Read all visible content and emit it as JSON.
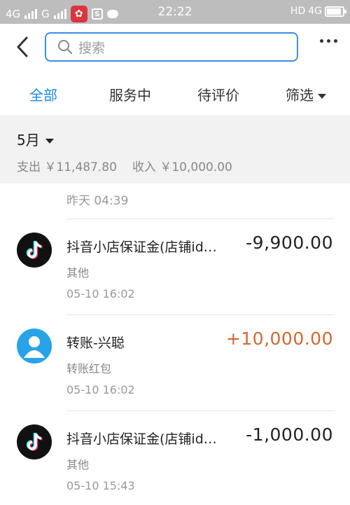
{
  "status_bar": {
    "left_net1": "4G",
    "left_net2": "G",
    "app_icon_glyph": "✿",
    "sq_icon_glyph": "S",
    "time": "22:22",
    "right_label": "HD",
    "right_net": "4G"
  },
  "search": {
    "placeholder": "搜索"
  },
  "tabs": [
    {
      "label": "全部",
      "active": true
    },
    {
      "label": "服务中",
      "active": false
    },
    {
      "label": "待评价",
      "active": false
    },
    {
      "label": "筛选",
      "active": false
    }
  ],
  "summary": {
    "month": "5月",
    "expense": "支出 ￥11,487.80",
    "income": "收入 ￥10,000.00"
  },
  "list": {
    "yesterday_time": "昨天 04:39",
    "items": [
      {
        "icon": "tiktok-icon",
        "title": "抖音小店保证金(店铺id…",
        "amount": "-9,900.00",
        "category": "其他",
        "time": "05-10  16:02"
      },
      {
        "icon": "user-avatar-icon",
        "title": "转账-兴聪",
        "amount": "+10,000.00",
        "category": "转账红包",
        "time": "05-10  16:02"
      },
      {
        "icon": "tiktok-icon",
        "title": "抖音小店保证金(店铺id…",
        "amount": "-1,000.00",
        "category": "其他",
        "time": "05-10  15:43"
      }
    ]
  },
  "colors": {
    "accent": "#1e88e5",
    "positive": "#d2692f",
    "summary_bg": "#f2f2f2",
    "status_bg": "#bdbdbd"
  }
}
